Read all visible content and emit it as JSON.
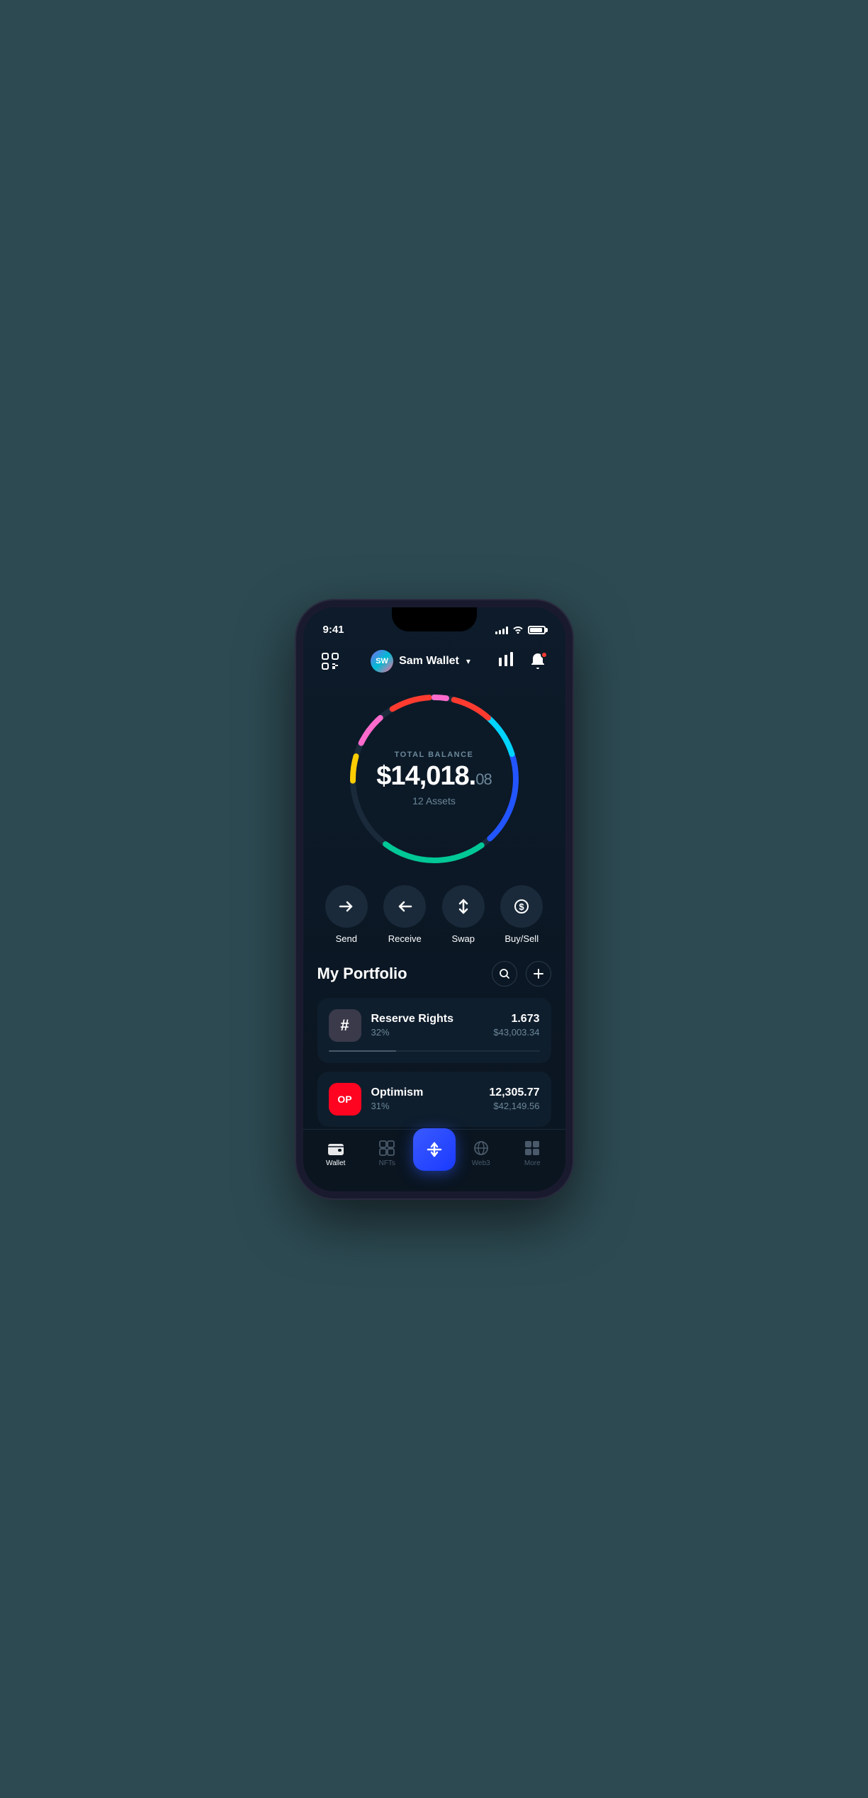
{
  "statusBar": {
    "time": "9:41"
  },
  "header": {
    "scanLabel": "scan",
    "walletAvatarText": "SW",
    "walletName": "Sam Wallet",
    "chartLabel": "chart",
    "notificationLabel": "notification"
  },
  "balance": {
    "label": "TOTAL BALANCE",
    "whole": "$14,018.",
    "cents": "08",
    "assets": "12 Assets"
  },
  "actions": [
    {
      "id": "send",
      "label": "Send",
      "icon": "→"
    },
    {
      "id": "receive",
      "label": "Receive",
      "icon": "←"
    },
    {
      "id": "swap",
      "label": "Swap",
      "icon": "↕"
    },
    {
      "id": "buysell",
      "label": "Buy/Sell",
      "icon": "$"
    }
  ],
  "portfolio": {
    "title": "My Portfolio",
    "searchLabel": "search",
    "addLabel": "add"
  },
  "assets": [
    {
      "id": "rsr",
      "name": "Reserve Rights",
      "percent": "32%",
      "amount": "1.673",
      "usd": "$43,003.34",
      "iconText": "#",
      "iconType": "rsr",
      "progressWidth": "32"
    },
    {
      "id": "op",
      "name": "Optimism",
      "percent": "31%",
      "amount": "12,305.77",
      "usd": "$42,149.56",
      "iconText": "OP",
      "iconType": "op",
      "progressWidth": "31"
    }
  ],
  "bottomNav": [
    {
      "id": "wallet",
      "label": "Wallet",
      "active": true
    },
    {
      "id": "nfts",
      "label": "NFTs",
      "active": false
    },
    {
      "id": "center",
      "label": "",
      "isCenter": true
    },
    {
      "id": "web3",
      "label": "Web3",
      "active": false
    },
    {
      "id": "more",
      "label": "More",
      "active": false
    }
  ],
  "colors": {
    "accent": "#3a5aff",
    "background": "#0d1b2a",
    "cardBackground": "#0f1e2d",
    "textPrimary": "#ffffff",
    "textSecondary": "#6b8899"
  }
}
